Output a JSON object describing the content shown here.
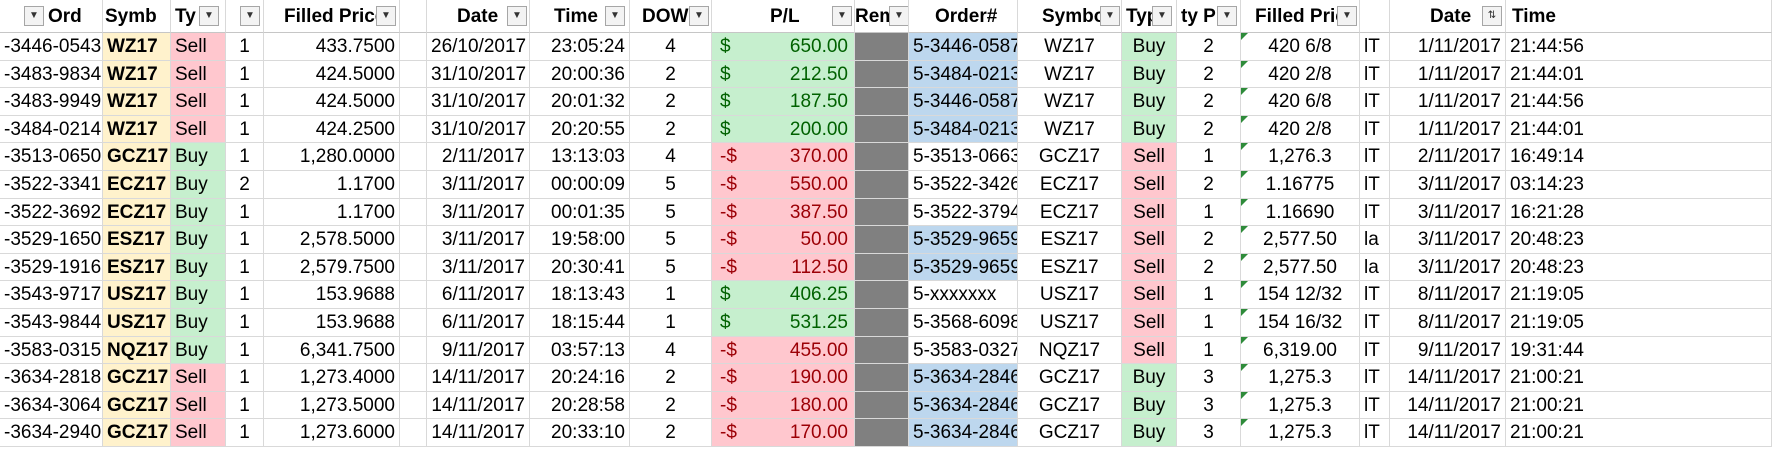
{
  "headers": {
    "order": "Ord",
    "symbol": "Symb",
    "type": "Ty",
    "filled_price": "Filled Price",
    "date": "Date",
    "time": "Time",
    "dow": "DOW",
    "pl": "P/L",
    "rem": "Rem",
    "order2": "Order#",
    "symbol2": "Symbo",
    "type2": "Typ",
    "qty2": "ty P",
    "filled_price2": "Filled Pric",
    "date2": "Date",
    "time2": "Time"
  },
  "colors": {
    "yellow": "#fff2cc",
    "red": "#ffc7ce",
    "green": "#c6efce",
    "blue": "#bdd7ee",
    "gray": "#808080",
    "pos_text": "#006100",
    "neg_text": "#9c0006"
  },
  "rows": [
    {
      "order": "-3446-0543",
      "symbol": "WZ17",
      "type": "Sell",
      "qty": "1",
      "price": "433.7500",
      "date": "26/10/2017",
      "time": "23:05:24",
      "dow": "4",
      "pl_sign": "$",
      "pl_val": "650.00",
      "pos": true,
      "order2": "5-3446-0587",
      "order2_blue": true,
      "symbol2": "WZ17",
      "type2": "Buy",
      "qty2": "2",
      "price2": "420 6/8",
      "x2": "lT",
      "date2": "1/11/2017",
      "time2": "21:44:56"
    },
    {
      "order": "-3483-9834",
      "symbol": "WZ17",
      "type": "Sell",
      "qty": "1",
      "price": "424.5000",
      "date": "31/10/2017",
      "time": "20:00:36",
      "dow": "2",
      "pl_sign": "$",
      "pl_val": "212.50",
      "pos": true,
      "order2": "5-3484-0213",
      "order2_blue": true,
      "symbol2": "WZ17",
      "type2": "Buy",
      "qty2": "2",
      "price2": "420 2/8",
      "x2": "lT",
      "date2": "1/11/2017",
      "time2": "21:44:01"
    },
    {
      "order": "-3483-9949",
      "symbol": "WZ17",
      "type": "Sell",
      "qty": "1",
      "price": "424.5000",
      "date": "31/10/2017",
      "time": "20:01:32",
      "dow": "2",
      "pl_sign": "$",
      "pl_val": "187.50",
      "pos": true,
      "order2": "5-3446-0587",
      "order2_blue": true,
      "symbol2": "WZ17",
      "type2": "Buy",
      "qty2": "2",
      "price2": "420 6/8",
      "x2": "lT",
      "date2": "1/11/2017",
      "time2": "21:44:56"
    },
    {
      "order": "-3484-0214",
      "symbol": "WZ17",
      "type": "Sell",
      "qty": "1",
      "price": "424.2500",
      "date": "31/10/2017",
      "time": "20:20:55",
      "dow": "2",
      "pl_sign": "$",
      "pl_val": "200.00",
      "pos": true,
      "order2": "5-3484-0213",
      "order2_blue": true,
      "symbol2": "WZ17",
      "type2": "Buy",
      "qty2": "2",
      "price2": "420 2/8",
      "x2": "lT",
      "date2": "1/11/2017",
      "time2": "21:44:01"
    },
    {
      "order": "-3513-0650",
      "symbol": "GCZ17",
      "type": "Buy",
      "qty": "1",
      "price": "1,280.0000",
      "date": "2/11/2017",
      "time": "13:13:03",
      "dow": "4",
      "pl_sign": "-$",
      "pl_val": "370.00",
      "pos": false,
      "order2": "5-3513-0663",
      "order2_blue": false,
      "symbol2": "GCZ17",
      "type2": "Sell",
      "qty2": "1",
      "price2": "1,276.3",
      "x2": "lT",
      "date2": "2/11/2017",
      "time2": "16:49:14"
    },
    {
      "order": "-3522-3341",
      "symbol": "ECZ17",
      "type": "Buy",
      "qty": "2",
      "price": "1.1700",
      "date": "3/11/2017",
      "time": "00:00:09",
      "dow": "5",
      "pl_sign": "-$",
      "pl_val": "550.00",
      "pos": false,
      "order2": "5-3522-3426",
      "order2_blue": false,
      "symbol2": "ECZ17",
      "type2": "Sell",
      "qty2": "2",
      "price2": "1.16775",
      "x2": "lT",
      "date2": "3/11/2017",
      "time2": "03:14:23"
    },
    {
      "order": "-3522-3692",
      "symbol": "ECZ17",
      "type": "Buy",
      "qty": "1",
      "price": "1.1700",
      "date": "3/11/2017",
      "time": "00:01:35",
      "dow": "5",
      "pl_sign": "-$",
      "pl_val": "387.50",
      "pos": false,
      "order2": "5-3522-3794",
      "order2_blue": false,
      "symbol2": "ECZ17",
      "type2": "Sell",
      "qty2": "1",
      "price2": "1.16690",
      "x2": "lT",
      "date2": "3/11/2017",
      "time2": "16:21:28"
    },
    {
      "order": "-3529-1650",
      "symbol": "ESZ17",
      "type": "Buy",
      "qty": "1",
      "price": "2,578.5000",
      "date": "3/11/2017",
      "time": "19:58:00",
      "dow": "5",
      "pl_sign": "-$",
      "pl_val": "50.00",
      "pos": false,
      "order2": "5-3529-9659",
      "order2_blue": true,
      "symbol2": "ESZ17",
      "type2": "Sell",
      "qty2": "2",
      "price2": "2,577.50",
      "x2": "la",
      "date2": "3/11/2017",
      "time2": "20:48:23"
    },
    {
      "order": "-3529-1916",
      "symbol": "ESZ17",
      "type": "Buy",
      "qty": "1",
      "price": "2,579.7500",
      "date": "3/11/2017",
      "time": "20:30:41",
      "dow": "5",
      "pl_sign": "-$",
      "pl_val": "112.50",
      "pos": false,
      "order2": "5-3529-9659",
      "order2_blue": true,
      "symbol2": "ESZ17",
      "type2": "Sell",
      "qty2": "2",
      "price2": "2,577.50",
      "x2": "la",
      "date2": "3/11/2017",
      "time2": "20:48:23"
    },
    {
      "order": "-3543-9717",
      "symbol": "USZ17",
      "type": "Buy",
      "qty": "1",
      "price": "153.9688",
      "date": "6/11/2017",
      "time": "18:13:43",
      "dow": "1",
      "pl_sign": "$",
      "pl_val": "406.25",
      "pos": true,
      "order2": "5-xxxxxxx",
      "order2_blue": false,
      "symbol2": "USZ17",
      "type2": "Sell",
      "qty2": "1",
      "price2": "154 12/32",
      "x2": "lT",
      "date2": "8/11/2017",
      "time2": "21:19:05"
    },
    {
      "order": "-3543-9844",
      "symbol": "USZ17",
      "type": "Buy",
      "qty": "1",
      "price": "153.9688",
      "date": "6/11/2017",
      "time": "18:15:44",
      "dow": "1",
      "pl_sign": "$",
      "pl_val": "531.25",
      "pos": true,
      "order2": "5-3568-6098",
      "order2_blue": false,
      "symbol2": "USZ17",
      "type2": "Sell",
      "qty2": "1",
      "price2": "154 16/32",
      "x2": "lT",
      "date2": "8/11/2017",
      "time2": "21:19:05"
    },
    {
      "order": "-3583-0315",
      "symbol": "NQZ17",
      "type": "Buy",
      "qty": "1",
      "price": "6,341.7500",
      "date": "9/11/2017",
      "time": "03:57:13",
      "dow": "4",
      "pl_sign": "-$",
      "pl_val": "455.00",
      "pos": false,
      "order2": "5-3583-0327",
      "order2_blue": false,
      "symbol2": "NQZ17",
      "type2": "Sell",
      "qty2": "1",
      "price2": "6,319.00",
      "x2": "lT",
      "date2": "9/11/2017",
      "time2": "19:31:44"
    },
    {
      "order": "-3634-2818",
      "symbol": "GCZ17",
      "type": "Sell",
      "qty": "1",
      "price": "1,273.4000",
      "date": "14/11/2017",
      "time": "20:24:16",
      "dow": "2",
      "pl_sign": "-$",
      "pl_val": "190.00",
      "pos": false,
      "order2": "5-3634-2846",
      "order2_blue": true,
      "symbol2": "GCZ17",
      "type2": "Buy",
      "qty2": "3",
      "price2": "1,275.3",
      "x2": "lT",
      "date2": "14/11/2017",
      "time2": "21:00:21"
    },
    {
      "order": "-3634-3064",
      "symbol": "GCZ17",
      "type": "Sell",
      "qty": "1",
      "price": "1,273.5000",
      "date": "14/11/2017",
      "time": "20:28:58",
      "dow": "2",
      "pl_sign": "-$",
      "pl_val": "180.00",
      "pos": false,
      "order2": "5-3634-2846",
      "order2_blue": true,
      "symbol2": "GCZ17",
      "type2": "Buy",
      "qty2": "3",
      "price2": "1,275.3",
      "x2": "lT",
      "date2": "14/11/2017",
      "time2": "21:00:21"
    },
    {
      "order": "-3634-2940",
      "symbol": "GCZ17",
      "type": "Sell",
      "qty": "1",
      "price": "1,273.6000",
      "date": "14/11/2017",
      "time": "20:33:10",
      "dow": "2",
      "pl_sign": "-$",
      "pl_val": "170.00",
      "pos": false,
      "order2": "5-3634-2846",
      "order2_blue": true,
      "symbol2": "GCZ17",
      "type2": "Buy",
      "qty2": "3",
      "price2": "1,275.3",
      "x2": "lT",
      "date2": "14/11/2017",
      "time2": "21:00:21"
    }
  ]
}
